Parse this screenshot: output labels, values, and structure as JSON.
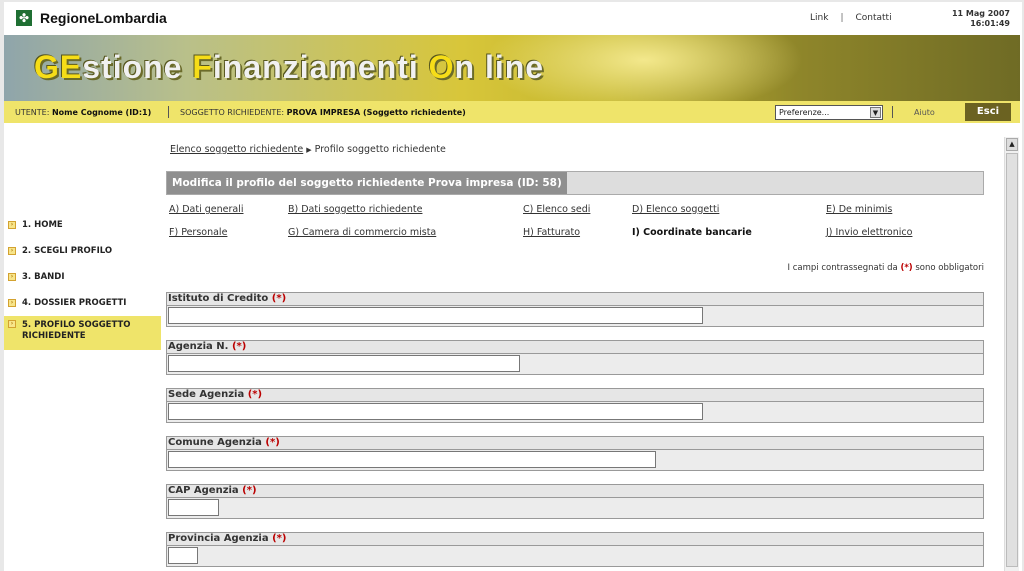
{
  "header": {
    "logo_text": "RegioneLombardia",
    "links": [
      "Link",
      "Contatti"
    ],
    "link_separator": "|",
    "date": "11 Mag 2007",
    "time": "16:01:49"
  },
  "banner": {
    "title_parts": [
      {
        "t": "GE",
        "hl": true
      },
      {
        "t": "stione ",
        "hl": false
      },
      {
        "t": "F",
        "hl": true
      },
      {
        "t": "inanziamenti ",
        "hl": false
      },
      {
        "t": "O",
        "hl": true
      },
      {
        "t": "n line",
        "hl": false
      }
    ]
  },
  "userbar": {
    "user_label": "UTENTE:",
    "user_value": "Nome Cognome (ID:1)",
    "subject_label": "SOGGETTO RICHIEDENTE:",
    "subject_value": "PROVA IMPRESA (Soggetto richiedente)",
    "preferences": "Preferenze...",
    "help": "Aiuto",
    "logout": "Esci"
  },
  "sidebar": {
    "items": [
      {
        "label": "1. HOME",
        "active": false
      },
      {
        "label": "2. SCEGLI PROFILO",
        "active": false
      },
      {
        "label": "3. BANDI",
        "active": false
      },
      {
        "label": "4. DOSSIER PROGETTI",
        "active": false
      },
      {
        "label": "5. PROFILO SOGGETTO RICHIEDENTE",
        "active": true
      }
    ]
  },
  "breadcrumb": {
    "parent": "Elenco soggetto richiedente",
    "current": "Profilo soggetto richiedente"
  },
  "section_title": "Modifica il profilo del soggetto richiedente Prova impresa (ID: 58)",
  "tabs": [
    {
      "label": "A) Dati generali",
      "active": false
    },
    {
      "label": "B) Dati soggetto richiedente",
      "active": false
    },
    {
      "label": "C) Elenco sedi",
      "active": false
    },
    {
      "label": "D) Elenco soggetti",
      "active": false
    },
    {
      "label": "E) De minimis",
      "active": false
    },
    {
      "label": "F) Personale",
      "active": false
    },
    {
      "label": "G) Camera di commercio mista",
      "active": false
    },
    {
      "label": "H) Fatturato",
      "active": false
    },
    {
      "label": "I) Coordinate bancarie",
      "active": true
    },
    {
      "label": "J) Invio elettronico",
      "active": false
    }
  ],
  "required_note": {
    "before": "I campi contrassegnati da",
    "marker": "(*)",
    "after": "sono obbligatori"
  },
  "fields": [
    {
      "label": "Istituto di Credito",
      "required": "(*)",
      "value": ""
    },
    {
      "label": "Agenzia N.",
      "required": "(*)",
      "value": ""
    },
    {
      "label": "Sede Agenzia",
      "required": "(*)",
      "value": ""
    },
    {
      "label": "Comune Agenzia",
      "required": "(*)",
      "value": ""
    },
    {
      "label": "CAP Agenzia",
      "required": "(*)",
      "value": ""
    },
    {
      "label": "Provincia Agenzia",
      "required": "(*)",
      "value": ""
    }
  ],
  "colors": {
    "accent_yellow": "#efe46a",
    "logout_bg": "#6b6221",
    "required_red": "#bb0000"
  }
}
